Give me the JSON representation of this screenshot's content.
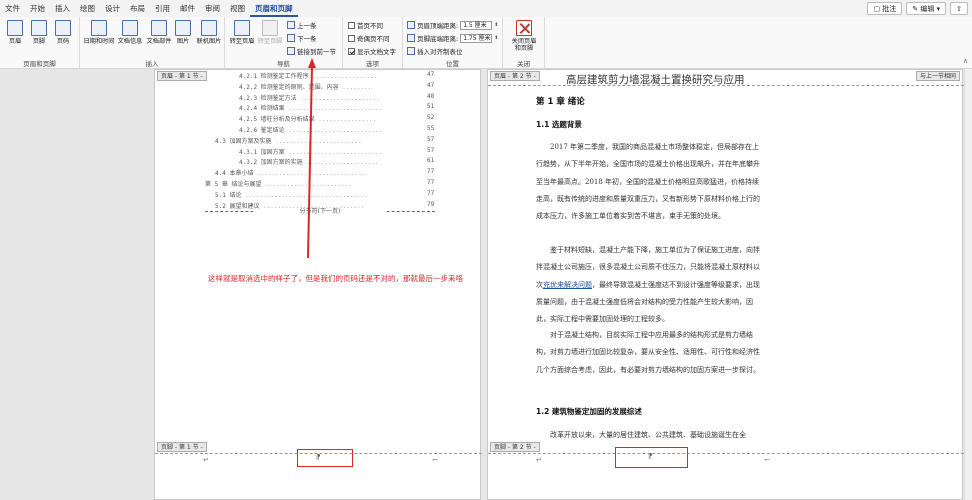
{
  "menu": {
    "tabs": [
      "文件",
      "开始",
      "插入",
      "绘图",
      "设计",
      "布局",
      "引用",
      "邮件",
      "审阅",
      "视图",
      "页眉和页脚"
    ],
    "active_index": 10,
    "comment_btn": "批注",
    "edit_btn": "编辑"
  },
  "ribbon": {
    "groups": {
      "header_footer": "页眉和页脚",
      "insert": "插入",
      "nav": "导航",
      "options": "选项",
      "position": "位置",
      "close": "关闭"
    },
    "header": "页眉",
    "footer": "页脚",
    "page_number": "页码",
    "datetime": "日期和时间",
    "docinfo": "文档信息",
    "docparts": "文档部件",
    "picture": "图片",
    "online_picture": "联机图片",
    "goto_header": "转至页眉",
    "goto_footer": "转至页脚",
    "previous": "上一条",
    "next": "下一条",
    "link_previous": "链接到前一节",
    "diff_first": "首页不同",
    "diff_odd_even": "奇偶页不同",
    "show_text": "显示文档文字",
    "header_top": "页眉顶端距离:",
    "header_top_val": "1.5 厘米",
    "footer_bottom": "页脚底端距离:",
    "footer_bottom_val": "1.75 厘米",
    "insert_align_tab": "插入对齐制表位",
    "close_label": "关闭页眉和页脚"
  },
  "left_page": {
    "header_tag": "页眉 - 第 1 节 -",
    "footer_tag": "页脚 - 第 1 节 -",
    "section_break": "分节符(下一页)",
    "toc": [
      {
        "text": "4.2.1 检测鉴定工作程序",
        "page": "47"
      },
      {
        "text": "4.2.2 检测鉴定的原则、范围、内容",
        "page": "47"
      },
      {
        "text": "4.2.3 检测鉴定方法",
        "page": "48"
      },
      {
        "text": "4.2.4 检测结果",
        "page": "51"
      },
      {
        "text": "4.2.5 墙柱分析及分析结果",
        "page": "52"
      },
      {
        "text": "4.2.6 鉴定结论",
        "page": "55"
      },
      {
        "text": "4.3 加固方案及实施",
        "page": "57"
      },
      {
        "text": "4.3.1 加固方案",
        "page": "57"
      },
      {
        "text": "4.3.2 加固方案的实施",
        "page": "61"
      },
      {
        "text": "4.4 本章小结",
        "page": "77"
      },
      {
        "text": "第 5 章 结论与展望",
        "page": "77"
      },
      {
        "text": "5.1 结论",
        "page": "77"
      },
      {
        "text": "5.2 展望和建议",
        "page": "79"
      }
    ]
  },
  "annotation": "这样就是取消选中的样子了，但是我们的页码还是不对的，那就最后一步来咯",
  "right_page": {
    "header_tag": "页眉 - 第 2 节 -",
    "same_as_prev": "与上一节相同",
    "footer_tag": "页脚 - 第 2 节 -",
    "title": "高层建筑剪力墙混凝土置换研究与应用",
    "chapter": "第 1 章 绪论",
    "sec1": "1.1 选题背景",
    "p1": "2017 年第二季度，我国的商品混凝土市场整体稳定，但局部存在上行趋势，从下半年开始，全国市场的混凝土价格出现飙升，并在年底攀升至当年最高点。2018 年初，全国的混凝土价格明显高歌猛进，价格持续走高，既有传统的进度和质量双重压力，又有新形势下原材料价格上行的成本压力，许多施工单位着实到苦不堪言，束手无策的处境。",
    "p2a": "鉴于材料短缺，混凝土产能下降，施工单位为了保证施工进度，向拌拌混凝土公司施压，很多混凝土公司质不住压力，只能将混凝土原材料以次",
    "p2link": "充优来解决问题",
    "p2b": "，最终导致混凝土强度达不到设计强度等级要求，出现质量问题，由于混凝土强度低将会对结构的受力性能产生较大影响，因此，实际工程中需要加固处理的工程较多。",
    "p3": "对于混凝土结构，目前实际工程中应用最多的结构形式是剪力墙结构，对剪力墙进行加固比较复杂，要从安全性、适用性、可行性和经济性几个方面综合考虑，因此，有必要对剪力墙结构的加固方案进一步探讨。",
    "sec2": "1.2 建筑物鉴定加固的发展综述",
    "p4": "改革开放以来，大量的居住建筑、公共建筑、基础设施诞生在全"
  }
}
